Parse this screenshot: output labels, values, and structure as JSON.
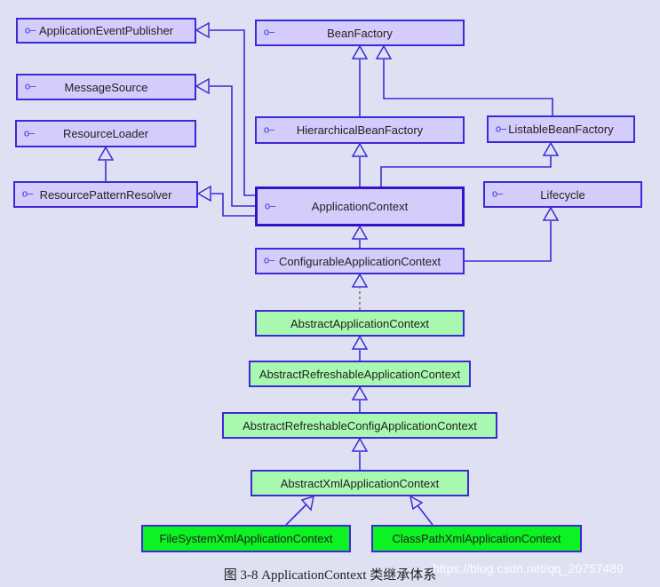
{
  "colors": {
    "background": "#dfe1f3",
    "interface": "#d4ccfb",
    "abstract": "#a8f8b0",
    "concrete": "#0cf222",
    "stroke": "#3b2bd6"
  },
  "icon": "interface-lollipop-icon",
  "nodes": {
    "applicationEventPublisher": {
      "label": "ApplicationEventPublisher",
      "kind": "interface"
    },
    "messageSource": {
      "label": "MessageSource",
      "kind": "interface"
    },
    "resourceLoader": {
      "label": "ResourceLoader",
      "kind": "interface"
    },
    "resourcePatternResolver": {
      "label": "ResourcePatternResolver",
      "kind": "interface"
    },
    "beanFactory": {
      "label": "BeanFactory",
      "kind": "interface"
    },
    "hierarchicalBeanFactory": {
      "label": "HierarchicalBeanFactory",
      "kind": "interface"
    },
    "listableBeanFactory": {
      "label": "ListableBeanFactory",
      "kind": "interface"
    },
    "applicationContext": {
      "label": "ApplicationContext",
      "kind": "interface"
    },
    "lifecycle": {
      "label": "Lifecycle",
      "kind": "interface"
    },
    "configurableApplicationContext": {
      "label": "ConfigurableApplicationContext",
      "kind": "interface"
    },
    "abstractApplicationContext": {
      "label": "AbstractApplicationContext",
      "kind": "abstract"
    },
    "abstractRefreshableApplicationContext": {
      "label": "AbstractRefreshableApplicationContext",
      "kind": "abstract"
    },
    "abstractRefreshableConfigApplicationContext": {
      "label": "AbstractRefreshableConfigApplicationContext",
      "kind": "abstract"
    },
    "abstractXmlApplicationContext": {
      "label": "AbstractXmlApplicationContext",
      "kind": "abstract"
    },
    "fileSystemXmlApplicationContext": {
      "label": "FileSystemXmlApplicationContext",
      "kind": "concrete"
    },
    "classPathXmlApplicationContext": {
      "label": "ClassPathXmlApplicationContext",
      "kind": "concrete"
    }
  },
  "edges": [
    {
      "from": "resourcePatternResolver",
      "to": "resourceLoader",
      "type": "extends"
    },
    {
      "from": "hierarchicalBeanFactory",
      "to": "beanFactory",
      "type": "extends"
    },
    {
      "from": "listableBeanFactory",
      "to": "beanFactory",
      "type": "extends"
    },
    {
      "from": "applicationContext",
      "to": "hierarchicalBeanFactory",
      "type": "extends"
    },
    {
      "from": "applicationContext",
      "to": "listableBeanFactory",
      "type": "extends"
    },
    {
      "from": "applicationContext",
      "to": "applicationEventPublisher",
      "type": "extends"
    },
    {
      "from": "applicationContext",
      "to": "messageSource",
      "type": "extends"
    },
    {
      "from": "applicationContext",
      "to": "resourcePatternResolver",
      "type": "extends"
    },
    {
      "from": "configurableApplicationContext",
      "to": "applicationContext",
      "type": "extends"
    },
    {
      "from": "configurableApplicationContext",
      "to": "lifecycle",
      "type": "extends"
    },
    {
      "from": "abstractApplicationContext",
      "to": "configurableApplicationContext",
      "type": "implements"
    },
    {
      "from": "abstractRefreshableApplicationContext",
      "to": "abstractApplicationContext",
      "type": "extends"
    },
    {
      "from": "abstractRefreshableConfigApplicationContext",
      "to": "abstractRefreshableApplicationContext",
      "type": "extends"
    },
    {
      "from": "abstractXmlApplicationContext",
      "to": "abstractRefreshableConfigApplicationContext",
      "type": "extends"
    },
    {
      "from": "fileSystemXmlApplicationContext",
      "to": "abstractXmlApplicationContext",
      "type": "extends"
    },
    {
      "from": "classPathXmlApplicationContext",
      "to": "abstractXmlApplicationContext",
      "type": "extends"
    }
  ],
  "caption": "图 3-8    ApplicationContext 类继承体系",
  "watermark": "https://blog.csdn.net/qq_20757489"
}
